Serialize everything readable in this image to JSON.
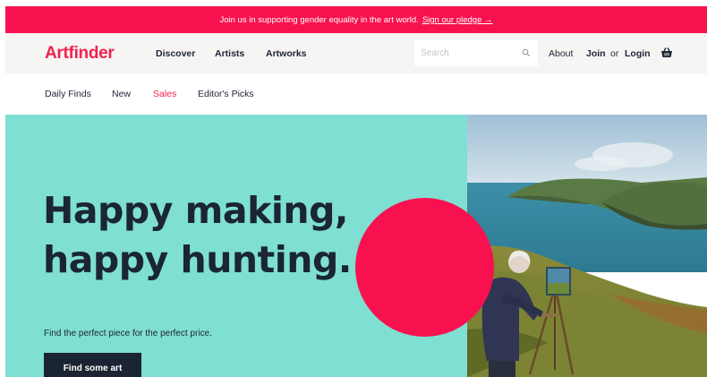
{
  "promo": {
    "message": "Join us in supporting gender equality in the art world.",
    "link_label": "Sign our pledge →"
  },
  "header": {
    "logo": "Artfinder",
    "nav": [
      "Discover",
      "Artists",
      "Artworks"
    ],
    "search_placeholder": "Search",
    "about": "About",
    "join": "Join",
    "or": "or",
    "login": "Login"
  },
  "subnav": {
    "items": [
      "Daily Finds",
      "New",
      "Sales",
      "Editor's Picks"
    ],
    "active": "Sales"
  },
  "hero": {
    "headline_line1": "Happy making,",
    "headline_line2": "happy hunting.",
    "tagline": "Find the perfect piece for the perfect price.",
    "cta_label": "Find some art"
  },
  "colors": {
    "brand_pink": "#f7124f",
    "mint": "#7fdfd3",
    "navy": "#1b2433"
  },
  "icons": [
    "search-icon",
    "basket-icon"
  ]
}
